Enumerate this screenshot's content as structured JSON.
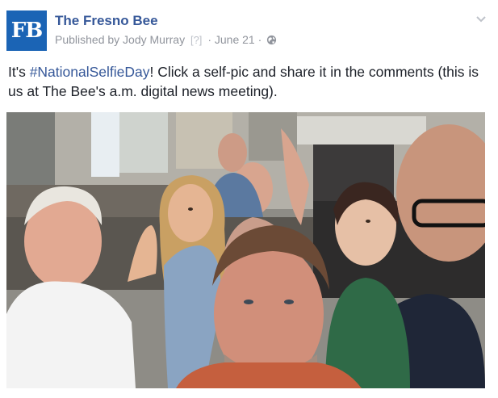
{
  "post": {
    "avatar_text": "FB",
    "page_name": "The Fresno Bee",
    "published_by": "Published by Jody Murray",
    "help_mark": "[?]",
    "separator": "·",
    "date": "June 21",
    "separator2": "·",
    "text_before": "It's ",
    "hashtag": "#NationalSelfieDay",
    "text_after": "! Click a self-pic and share it in the comments (this is us at The Bee's a.m. digital news meeting)."
  },
  "icons": {
    "privacy": "globe-icon",
    "menu": "chevron-down-icon"
  },
  "colors": {
    "brand_blue": "#1b64b5",
    "link_blue": "#365899",
    "meta_gray": "#90949c",
    "text": "#1d2129"
  }
}
